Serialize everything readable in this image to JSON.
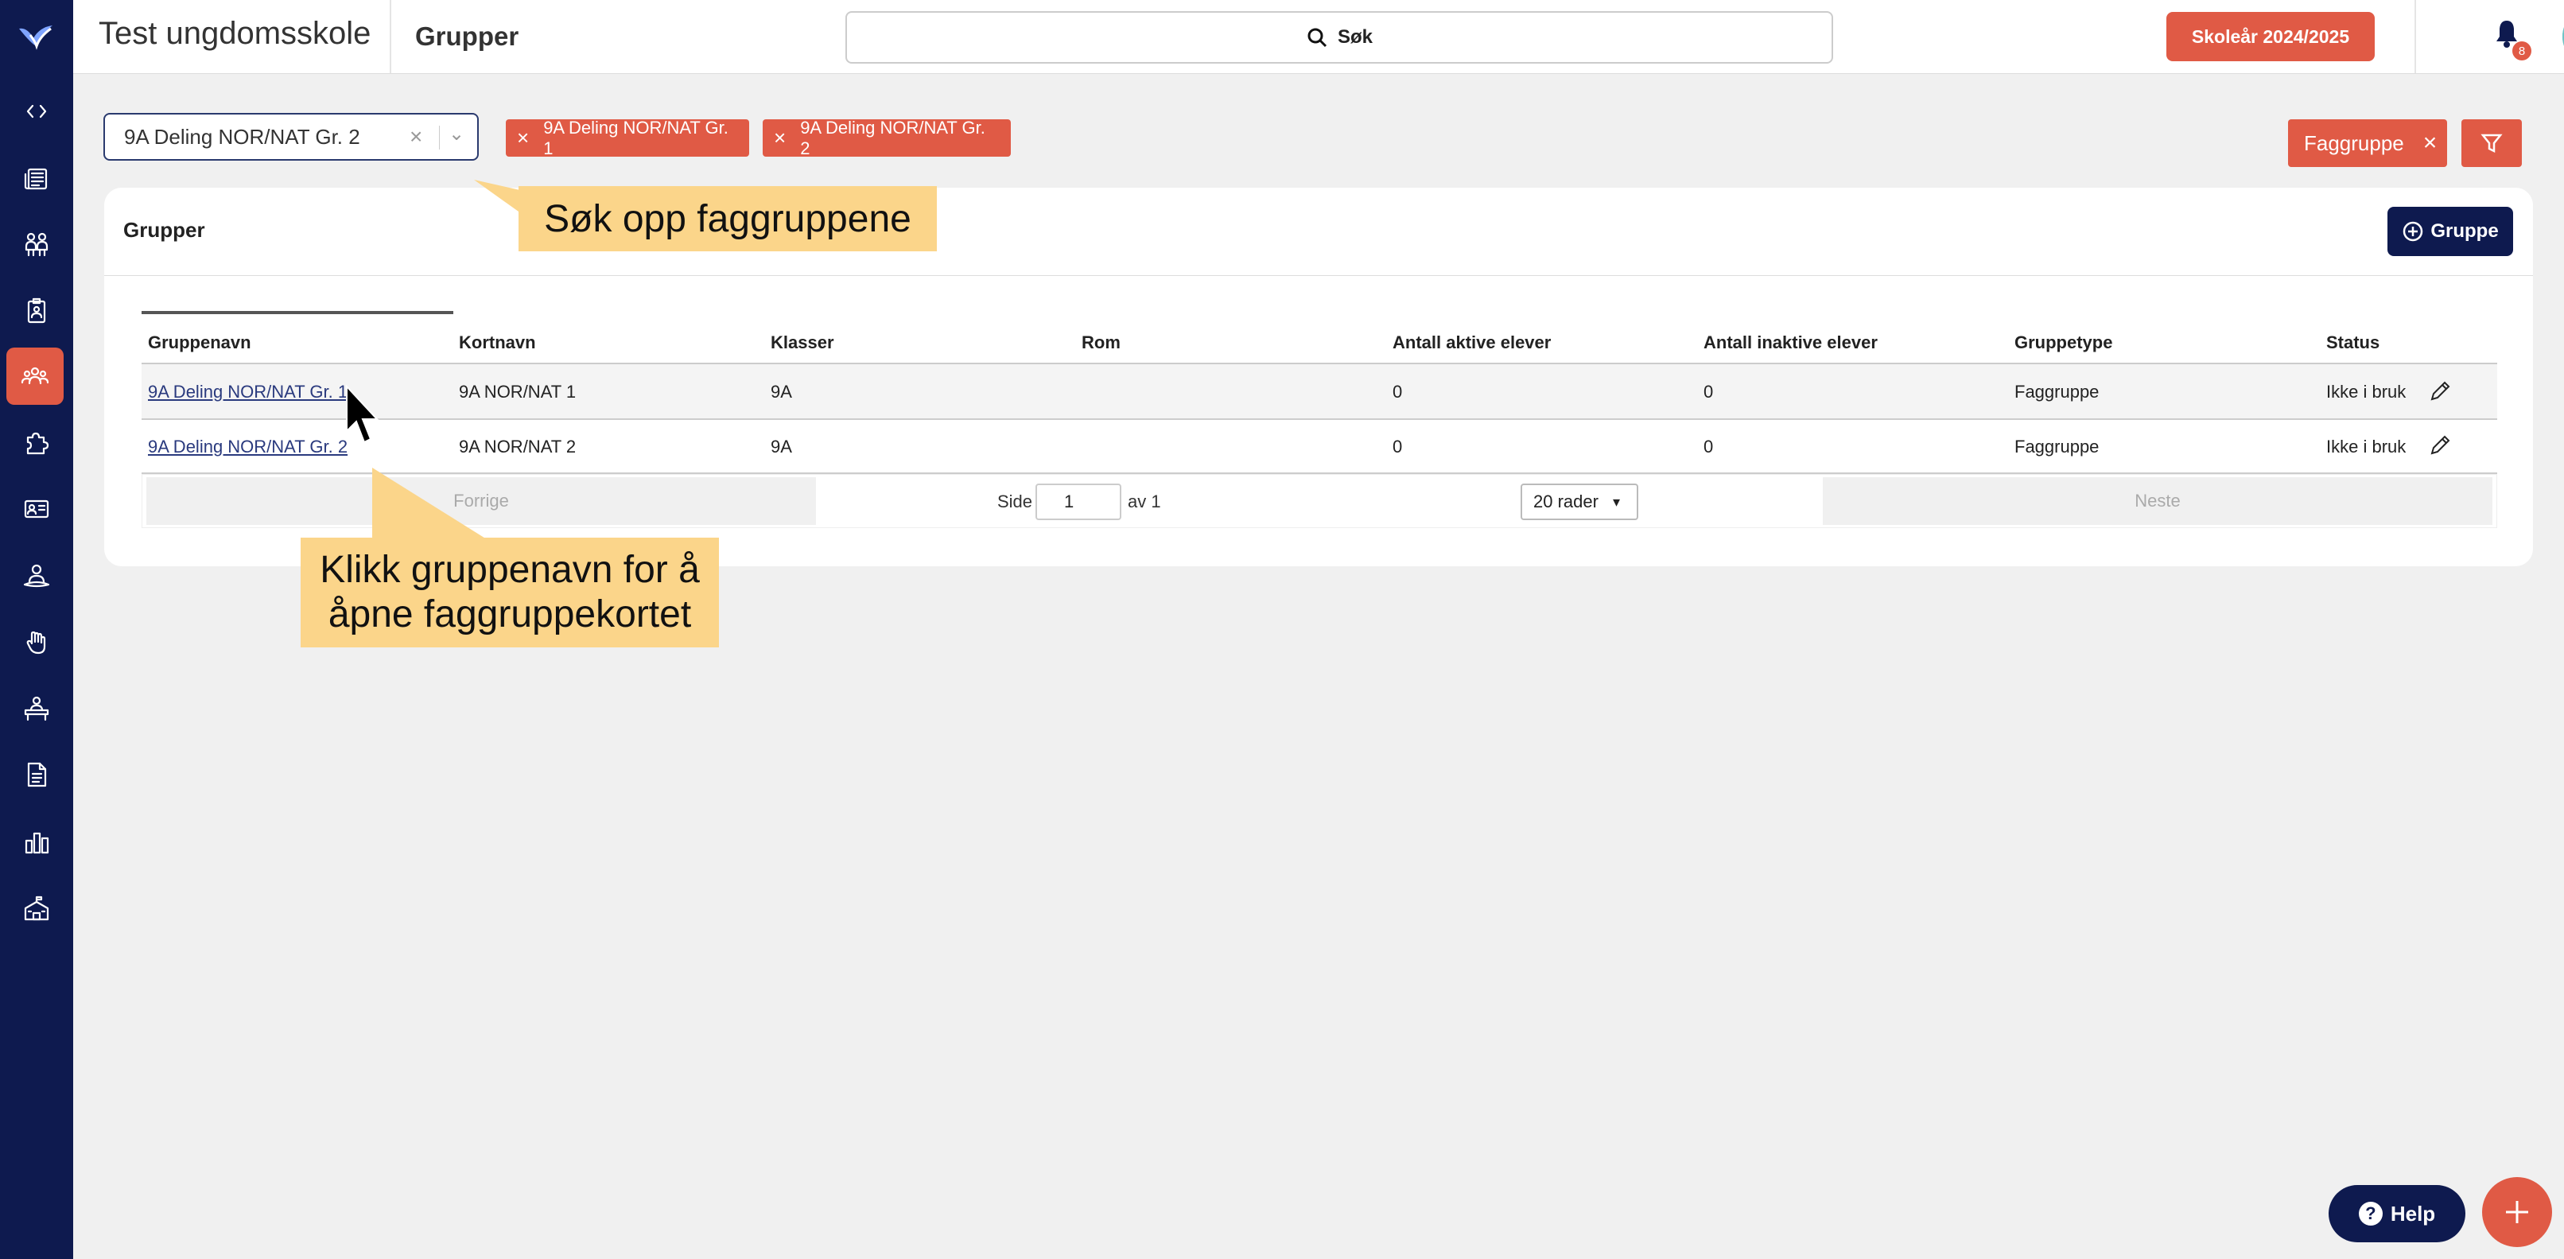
{
  "header": {
    "school_name": "Test ungdomsskole",
    "page_title": "Grupper",
    "search_label": "Søk",
    "school_year_button": "Skoleår 2024/2025",
    "notification_count": "8"
  },
  "sidebar": {
    "icons": [
      "toggle-sidebar-icon",
      "news-icon",
      "people-icon",
      "clipboard-person-icon",
      "groups-icon",
      "puzzle-icon",
      "id-card-icon",
      "person-support-icon",
      "hand-raise-icon",
      "desk-icon",
      "document-icon",
      "bar-chart-icon",
      "school-building-icon"
    ],
    "active": "groups-icon"
  },
  "filters": {
    "select_value": "9A Deling NOR/NAT Gr. 2",
    "chips": [
      "9A Deling NOR/NAT Gr. 1",
      "9A Deling NOR/NAT Gr. 2"
    ],
    "type_chip": "Faggruppe"
  },
  "card": {
    "title": "Grupper",
    "add_button": "Gruppe"
  },
  "table": {
    "columns": [
      "Gruppenavn",
      "Kortnavn",
      "Klasser",
      "Rom",
      "Antall aktive elever",
      "Antall inaktive elever",
      "Gruppetype",
      "Status"
    ],
    "rows": [
      {
        "name": "9A Deling NOR/NAT Gr. 1",
        "short": "9A NOR/NAT 1",
        "classes": "9A",
        "room": "",
        "active": "0",
        "inactive": "0",
        "type": "Faggruppe",
        "status": "Ikke i bruk"
      },
      {
        "name": "9A Deling NOR/NAT Gr. 2",
        "short": "9A NOR/NAT 2",
        "classes": "9A",
        "room": "",
        "active": "0",
        "inactive": "0",
        "type": "Faggruppe",
        "status": "Ikke i bruk"
      }
    ]
  },
  "pagination": {
    "prev": "Forrige",
    "next": "Neste",
    "page_label": "Side",
    "page_value": "1",
    "of_label": "av 1",
    "rows_select": "20 rader"
  },
  "callouts": {
    "search_hint": "Søk opp faggruppene",
    "click_hint_line1": "Klikk gruppenavn for å",
    "click_hint_line2": "åpne faggruppekortet"
  },
  "help_button": "Help",
  "colors": {
    "sidebar": "#0e1a4f",
    "accent": "#e05a45",
    "callout": "#fbd58a",
    "primary_button": "#0e1a4f"
  }
}
